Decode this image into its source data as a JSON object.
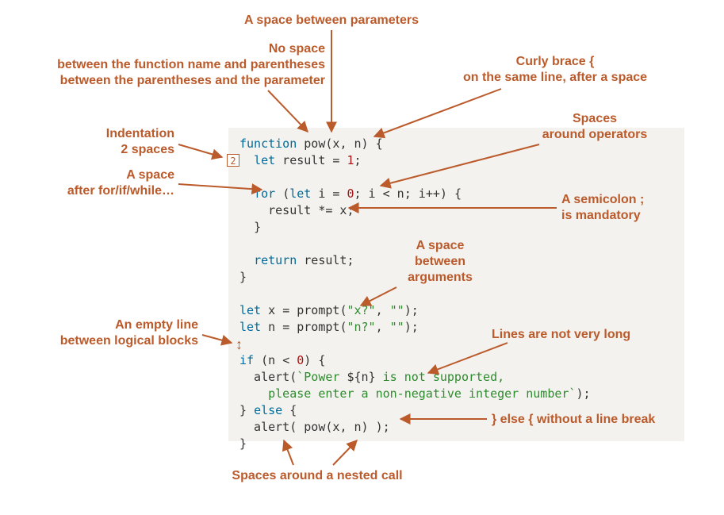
{
  "labels": {
    "space_between_params": "A space between parameters",
    "no_space_fn": "No space\nbetween the function name and parentheses\nbetween the parentheses and the parameter",
    "curly_same_line": "Curly brace {\non the same line, after a space",
    "spaces_operators": "Spaces\naround operators",
    "indent_2": "Indentation\n2 spaces",
    "space_after_for": "A space\nafter for/if/while…",
    "semicolon": "A semicolon ;\nis mandatory",
    "space_args": "A space\nbetween\narguments",
    "empty_line": "An empty line\nbetween logical blocks",
    "lines_not_long": "Lines are not very long",
    "else_no_break": "} else { without a line break",
    "spaces_nested": "Spaces around a nested call"
  },
  "code_tokens": {
    "function": "function",
    "pow": "pow",
    "params": "(x, n)",
    "open_brace": "{",
    "let": "let",
    "result": "result",
    "eq1": "= 1",
    "semi": ";",
    "for": "for",
    "for_head": "(let i = 0; i < n; i++)",
    "res_mul": "result *= x;",
    "return": "return",
    "return_val": "result;",
    "x_assign": "x = prompt",
    "xargs": "(\"x?\", \"\")",
    "n_assign": "n = prompt",
    "nargs": "(\"n?\", \"\")",
    "if": "if",
    "if_cond": "(n < 0)",
    "alert1a": "alert(`Power ${n} is not supported,",
    "alert1b": "    please enter a non-negative integer number`);",
    "else": "} else {",
    "alert2": "alert( pow(x, n) );"
  },
  "badge": "2",
  "colors": {
    "accent": "#bb5a2a"
  }
}
